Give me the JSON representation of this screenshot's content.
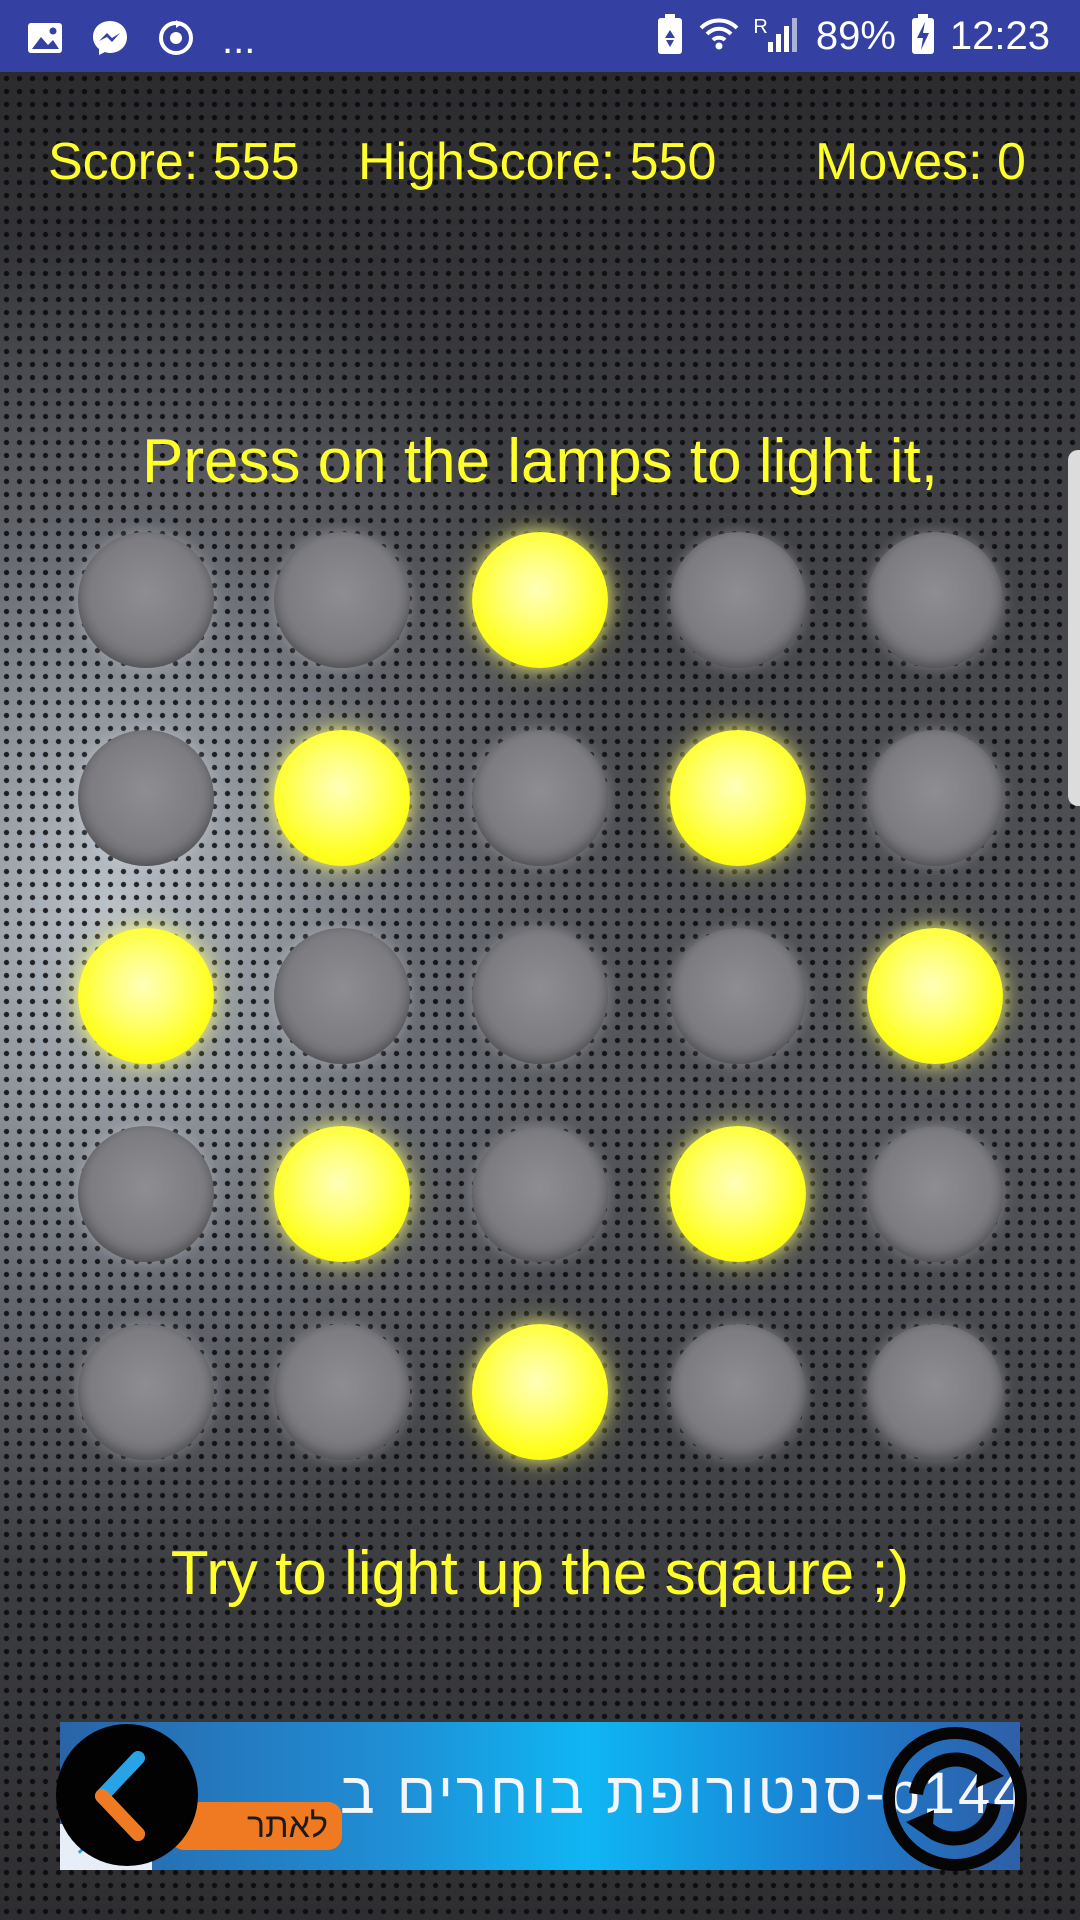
{
  "status_bar": {
    "left_icons": [
      "gallery-icon",
      "messenger-icon",
      "sync-icon"
    ],
    "more": "...",
    "right_icons": [
      "battery-saver-icon",
      "wifi-icon",
      "signal-icon"
    ],
    "roaming": "R",
    "battery": "89%",
    "time": "12:23",
    "bar_color": "#3441a3"
  },
  "hud": {
    "score": "Score: 555",
    "highscore": "HighScore: 550",
    "moves": "Moves: 0",
    "text_color": "#ffff2b"
  },
  "instructions": {
    "top": "Press on the lamps to light it,",
    "bottom": "Try to light up the sqaure ;)"
  },
  "grid": {
    "rows": 5,
    "cols": 5,
    "lamps_on": [
      [
        false,
        false,
        true,
        false,
        false
      ],
      [
        false,
        true,
        false,
        true,
        false
      ],
      [
        true,
        false,
        false,
        false,
        true
      ],
      [
        false,
        true,
        false,
        true,
        false
      ],
      [
        false,
        false,
        true,
        false,
        false
      ]
    ],
    "on_color": "#ffff1e",
    "off_color": "#7d7d81"
  },
  "ad": {
    "text": "סנטורופת בוחרים ב-b144",
    "button_label": "לאתר",
    "close_label": "✕"
  },
  "controls": {
    "back_icon": "back-arrow-icon",
    "refresh_icon": "refresh-icon"
  }
}
